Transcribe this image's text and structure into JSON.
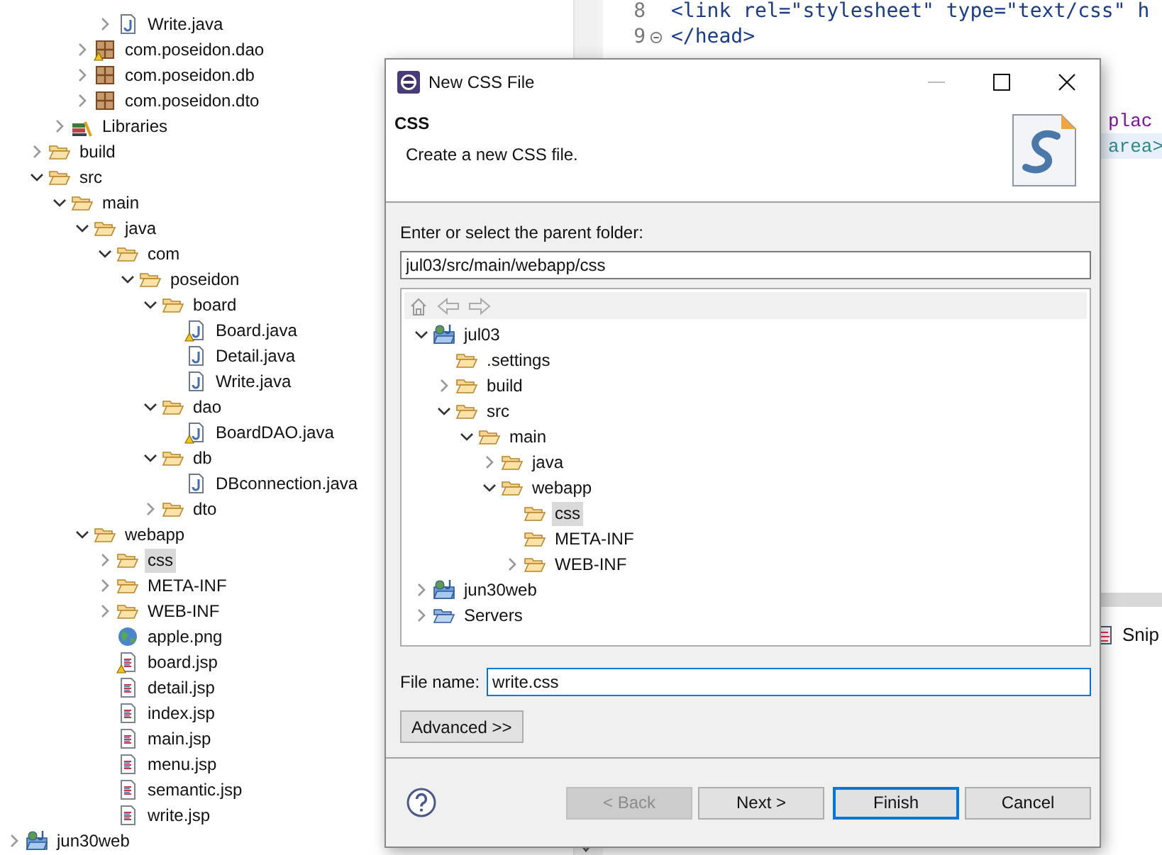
{
  "explorer": {
    "items": [
      {
        "children": [
          {
            "children": [
              {
                "children": [
                  {
                    "children": [
                      {
                        "label": "Write.java",
                        "kind": "java",
                        "expanded": false
                      }
                    ]
                  },
                  {
                    "label": "com.poseidon.dao",
                    "kind": "package",
                    "expanded": false,
                    "warning": true
                  },
                  {
                    "label": "com.poseidon.db",
                    "kind": "package",
                    "expanded": false
                  },
                  {
                    "label": "com.poseidon.dto",
                    "kind": "package",
                    "expanded": false
                  }
                ]
              },
              {
                "label": "Libraries",
                "kind": "library",
                "expanded": false
              }
            ]
          },
          {
            "label": "build",
            "kind": "folder",
            "expanded": false
          },
          {
            "label": "src",
            "kind": "folder",
            "expanded": true,
            "children": [
              {
                "label": "main",
                "kind": "folder",
                "expanded": true,
                "children": [
                  {
                    "label": "java",
                    "kind": "folder",
                    "expanded": true,
                    "children": [
                      {
                        "label": "com",
                        "kind": "folder",
                        "expanded": true,
                        "children": [
                          {
                            "label": "poseidon",
                            "kind": "folder",
                            "expanded": true,
                            "children": [
                              {
                                "label": "board",
                                "kind": "folder",
                                "expanded": true,
                                "children": [
                                  {
                                    "label": "Board.java",
                                    "kind": "java",
                                    "warning": true
                                  },
                                  {
                                    "label": "Detail.java",
                                    "kind": "java"
                                  },
                                  {
                                    "label": "Write.java",
                                    "kind": "java"
                                  }
                                ]
                              },
                              {
                                "label": "dao",
                                "kind": "folder",
                                "expanded": true,
                                "children": [
                                  {
                                    "label": "BoardDAO.java",
                                    "kind": "java",
                                    "warning": true
                                  }
                                ]
                              },
                              {
                                "label": "db",
                                "kind": "folder",
                                "expanded": true,
                                "children": [
                                  {
                                    "label": "DBconnection.java",
                                    "kind": "java"
                                  }
                                ]
                              },
                              {
                                "label": "dto",
                                "kind": "folder",
                                "expanded": false
                              }
                            ]
                          }
                        ]
                      }
                    ]
                  },
                  {
                    "label": "webapp",
                    "kind": "folder",
                    "expanded": true,
                    "children": [
                      {
                        "label": "css",
                        "kind": "folder",
                        "expanded": false,
                        "selected": true
                      },
                      {
                        "label": "META-INF",
                        "kind": "folder",
                        "expanded": false,
                        "selected": false
                      },
                      {
                        "label": "WEB-INF",
                        "kind": "folder",
                        "expanded": false,
                        "selected": false
                      },
                      {
                        "label": "apple.png",
                        "kind": "image"
                      },
                      {
                        "label": "board.jsp",
                        "kind": "jsp",
                        "warning": true
                      },
                      {
                        "label": "detail.jsp",
                        "kind": "jsp"
                      },
                      {
                        "label": "index.jsp",
                        "kind": "jsp"
                      },
                      {
                        "label": "main.jsp",
                        "kind": "jsp"
                      },
                      {
                        "label": "menu.jsp",
                        "kind": "jsp"
                      },
                      {
                        "label": "semantic.jsp",
                        "kind": "jsp"
                      },
                      {
                        "label": "write.jsp",
                        "kind": "jsp"
                      }
                    ]
                  }
                ]
              }
            ]
          }
        ]
      },
      {
        "label": "jun30web",
        "kind": "project",
        "expanded": false
      }
    ]
  },
  "editor": {
    "lines": [
      {
        "number": "8",
        "code": "    <link rel=\"stylesheet\" type=\"text/css\" h"
      },
      {
        "number": "9",
        "fold": true,
        "code": "</head>"
      }
    ],
    "fragments": [
      {
        "text": "plac",
        "kind": "attr",
        "current": false
      },
      {
        "text": "area>",
        "kind": "tag",
        "current": true
      }
    ],
    "bottom_tab": "Snip"
  },
  "dialog": {
    "title": "New CSS File",
    "heading": "CSS",
    "description": "Create a new CSS file.",
    "folder_label": "Enter or select the parent folder:",
    "folder_value": "jul03/src/main/webapp/css",
    "tree": [
      {
        "label": "jul03",
        "kind": "project",
        "expanded": true,
        "children": [
          {
            "label": ".settings",
            "kind": "folder"
          },
          {
            "label": "build",
            "kind": "folder",
            "expanded": false
          },
          {
            "label": "src",
            "kind": "folder",
            "expanded": true,
            "children": [
              {
                "label": "main",
                "kind": "folder",
                "expanded": true,
                "children": [
                  {
                    "label": "java",
                    "kind": "folder",
                    "expanded": false
                  },
                  {
                    "label": "webapp",
                    "kind": "folder",
                    "expanded": true,
                    "children": [
                      {
                        "label": "css",
                        "kind": "folder",
                        "selected": true
                      },
                      {
                        "label": "META-INF",
                        "kind": "folder",
                        "selected": false
                      },
                      {
                        "label": "WEB-INF",
                        "kind": "folder",
                        "expanded": false,
                        "selected": false
                      }
                    ]
                  }
                ]
              }
            ]
          }
        ]
      },
      {
        "label": "jun30web",
        "kind": "project",
        "expanded": false
      },
      {
        "label": "Servers",
        "kind": "servers",
        "expanded": false
      }
    ],
    "file_label": "File name:",
    "file_value": "write.css",
    "advanced_button": "Advanced >>",
    "buttons": [
      {
        "label": "< Back",
        "disabled": true,
        "default": false
      },
      {
        "label": "Next >",
        "disabled": false,
        "default": false
      },
      {
        "label": "Finish",
        "disabled": false,
        "default": true
      },
      {
        "label": "Cancel",
        "disabled": false,
        "default": false
      }
    ]
  }
}
